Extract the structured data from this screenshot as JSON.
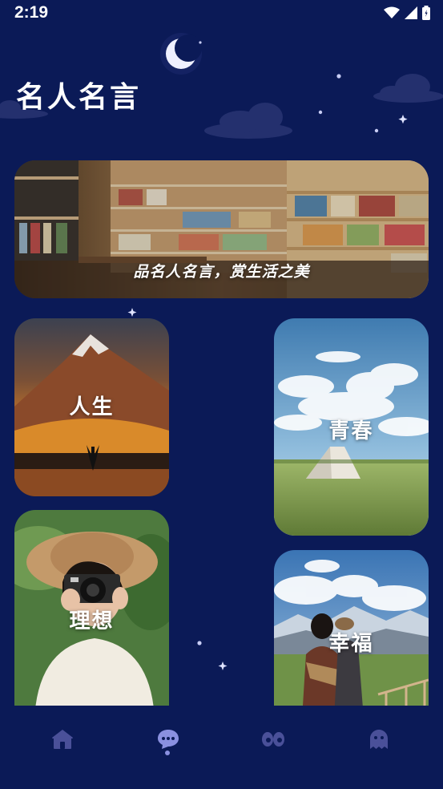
{
  "status_bar": {
    "time": "2:19"
  },
  "header": {
    "title": "名人名言"
  },
  "banner": {
    "caption": "品名人名言，赏生活之美"
  },
  "categories": [
    {
      "label": "人生"
    },
    {
      "label": "青春"
    },
    {
      "label": "理想"
    },
    {
      "label": "幸福"
    }
  ],
  "bottom_nav": {
    "items": [
      {
        "icon": "home-icon",
        "active": false
      },
      {
        "icon": "chat-bubble-icon",
        "active": true
      },
      {
        "icon": "eyes-icon",
        "active": false
      },
      {
        "icon": "ghost-icon",
        "active": false
      }
    ]
  },
  "colors": {
    "background": "#0b1a57",
    "nav_inactive": "#4a5099",
    "nav_active": "#8a90e0"
  }
}
